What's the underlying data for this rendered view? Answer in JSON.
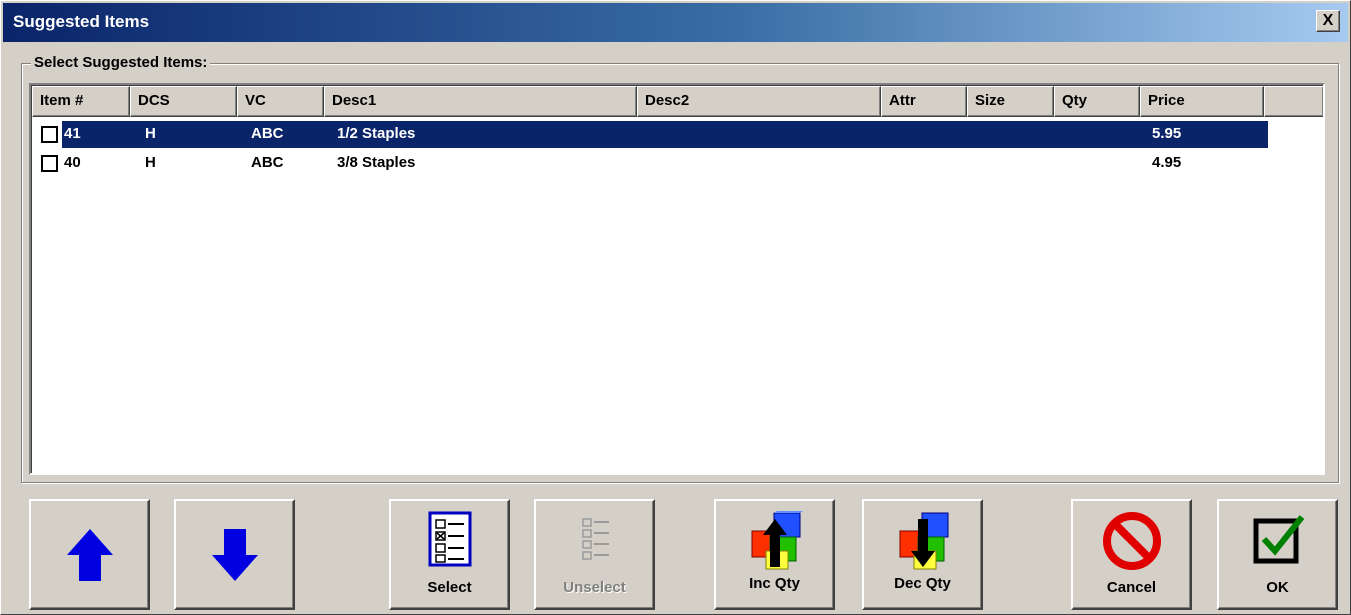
{
  "window": {
    "title": "Suggested Items",
    "close_label": "X"
  },
  "group": {
    "label": "Select Suggested Items:"
  },
  "table": {
    "columns": [
      "Item #",
      "DCS",
      "VC",
      "Desc1",
      "Desc2",
      "Attr",
      "Size",
      "Qty",
      "Price"
    ],
    "rows": [
      {
        "item": "41",
        "dcs": "H",
        "vc": "ABC",
        "desc1": "1/2 Staples",
        "desc2": "",
        "attr": "",
        "size": "",
        "qty": "",
        "price": "5.95",
        "checked": false,
        "selected": true
      },
      {
        "item": "40",
        "dcs": "H",
        "vc": "ABC",
        "desc1": "3/8 Staples",
        "desc2": "",
        "attr": "",
        "size": "",
        "qty": "",
        "price": "4.95",
        "checked": false,
        "selected": false
      }
    ]
  },
  "buttons": {
    "up_icon": "arrow-up-icon",
    "down_icon": "arrow-down-icon",
    "select": "Select",
    "unselect": "Unselect",
    "inc_qty": "Inc Qty",
    "dec_qty": "Dec Qty",
    "cancel": "Cancel",
    "ok": "OK"
  },
  "colors": {
    "selection": "#0a246a",
    "arrow": "#0000e0",
    "cancel": "#e00000",
    "ok_check": "#008000"
  }
}
